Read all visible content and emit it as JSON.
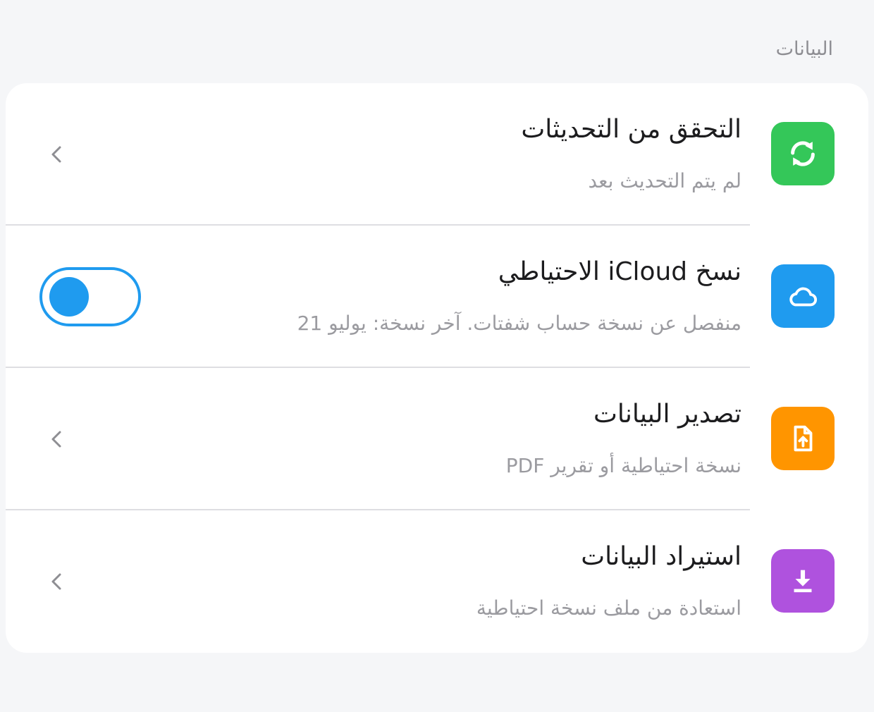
{
  "section": {
    "title": "البيانات"
  },
  "rows": [
    {
      "title": "التحقق من التحديثات",
      "subtitle": "لم يتم التحديث بعد",
      "icon": "refresh-icon",
      "color": "#34c759",
      "trailing": "chevron-left-icon"
    },
    {
      "title": "نسخ iCloud الاحتياطي",
      "subtitle": "منفصل عن نسخة حساب شفتات. آخر نسخة: يوليو 21",
      "icon": "cloud-icon",
      "color": "#1f9bef",
      "trailing": "toggle",
      "toggle_on": false
    },
    {
      "title": "تصدير البيانات",
      "subtitle": "نسخة احتياطية أو تقرير PDF",
      "icon": "file-export-icon",
      "color": "#ff9500",
      "trailing": "chevron-left-icon"
    },
    {
      "title": "استيراد البيانات",
      "subtitle": "استعادة من ملف نسخة احتياطية",
      "icon": "download-icon",
      "color": "#af52de",
      "trailing": "chevron-left-icon"
    }
  ],
  "colors": {
    "accent": "#1f9bef",
    "background": "#f5f6f8",
    "card": "#ffffff",
    "title": "#1c1c1e",
    "subtitle": "#9b9ba0",
    "chevron": "#8e8e93",
    "divider": "#dedee2"
  }
}
